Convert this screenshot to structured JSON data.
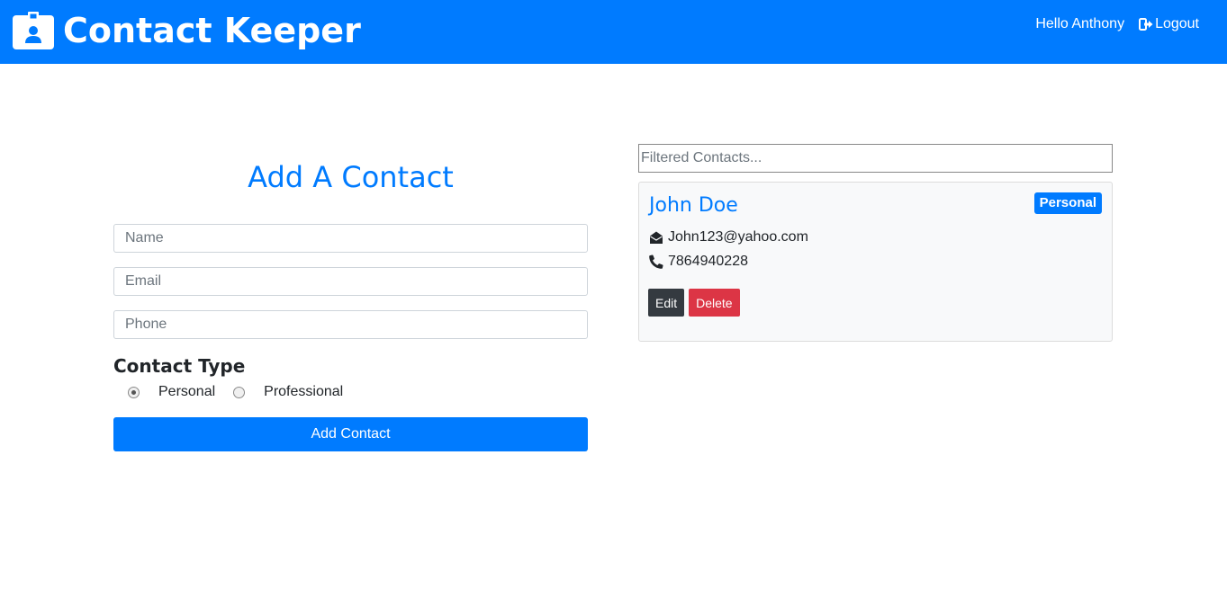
{
  "navbar": {
    "brand_icon": "id-badge-icon",
    "title": "Contact Keeper",
    "greeting": "Hello Anthony",
    "logout_icon": "sign-out-icon",
    "logout_label": "Logout",
    "bg_color": "#007bff"
  },
  "form": {
    "title": "Add A Contact",
    "name_placeholder": "Name",
    "email_placeholder": "Email",
    "phone_placeholder": "Phone",
    "type_heading": "Contact Type",
    "radio_personal": "Personal",
    "radio_professional": "Professional",
    "selected_type": "Personal",
    "submit_label": "Add Contact"
  },
  "filter": {
    "placeholder": "Filtered Contacts..."
  },
  "contacts": [
    {
      "name": "John Doe",
      "type_badge": "Personal",
      "email_icon": "envelope-open-icon",
      "email": "John123@yahoo.com",
      "phone_icon": "phone-icon",
      "phone": "7864940228",
      "edit_label": "Edit",
      "delete_label": "Delete"
    }
  ],
  "colors": {
    "primary": "#007bff",
    "dark": "#343a40",
    "danger": "#dc3545"
  }
}
